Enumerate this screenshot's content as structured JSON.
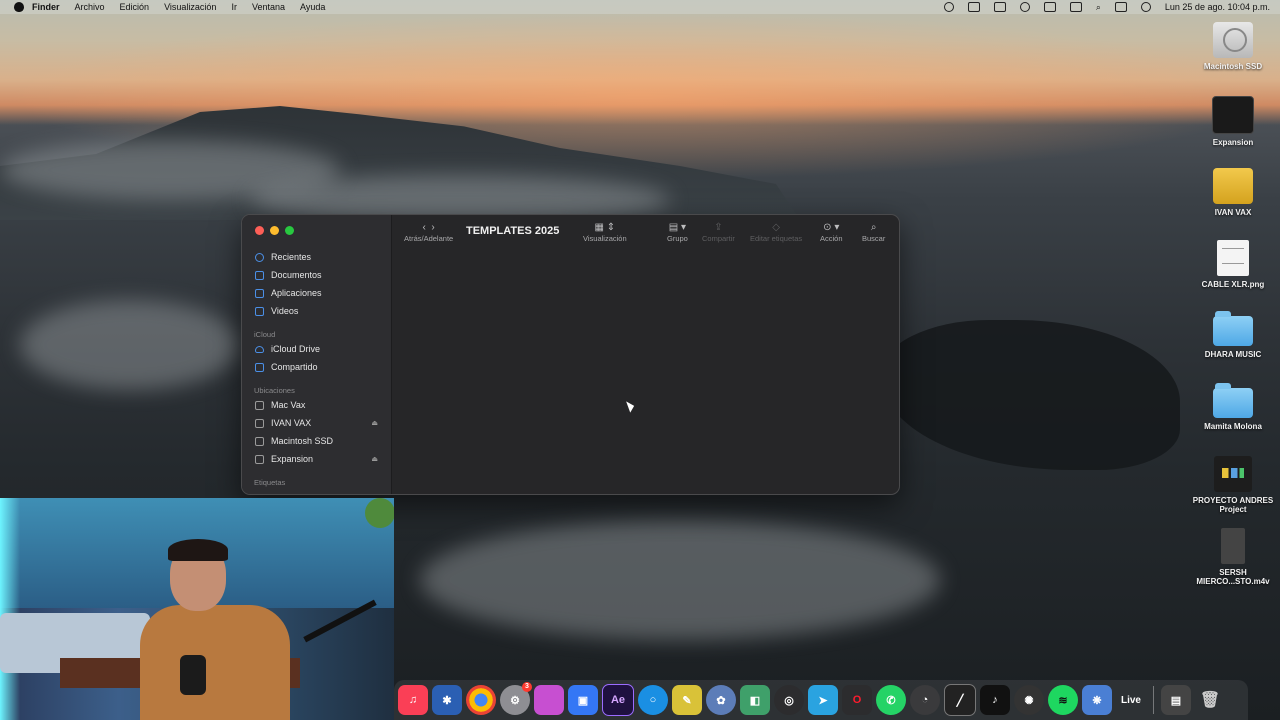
{
  "menubar": {
    "app": "Finder",
    "items": [
      "Archivo",
      "Edición",
      "Visualización",
      "Ir",
      "Ventana",
      "Ayuda"
    ],
    "datetime": "Lun 25 de ago. 10:04 p.m."
  },
  "finder": {
    "title": "TEMPLATES 2025",
    "toolbar": {
      "back_forward": "Atrás/Adelante",
      "view": "Visualización",
      "group": "Grupo",
      "share": "Compartir",
      "tags": "Editar etiquetas",
      "action": "Acción",
      "search": "Buscar"
    },
    "sidebar": {
      "favorites": [
        "Recientes",
        "Documentos",
        "Aplicaciones",
        "Videos"
      ],
      "icloud_header": "iCloud",
      "icloud": [
        "iCloud Drive",
        "Compartido"
      ],
      "locations_header": "Ubicaciones",
      "locations": [
        "Mac Vax",
        "IVAN VAX",
        "Macintosh SSD",
        "Expansion"
      ],
      "tags_header": "Etiquetas"
    }
  },
  "desktop": {
    "icons": [
      {
        "label": "Macintosh SSD",
        "kind": "hd-icon"
      },
      {
        "label": "Expansion",
        "kind": "drive-icon"
      },
      {
        "label": "IVAN VAX",
        "kind": "usb-drive-icon"
      },
      {
        "label": "CABLE XLR.png",
        "kind": "image-file-icon"
      },
      {
        "label": "DHARA MUSIC",
        "kind": "folder-icon"
      },
      {
        "label": "Mamita Molona",
        "kind": "folder-icon"
      },
      {
        "label": "PROYECTO ANDRES Project",
        "kind": "project-file-icon"
      },
      {
        "label": "SERSH MIERCO...STO.m4v",
        "kind": "video-file-icon"
      }
    ]
  },
  "dock": {
    "ae_label": "Ae",
    "live_label": "Live",
    "badge": "3"
  },
  "colors": {
    "close": "#fe5f57",
    "minimize": "#febc2e",
    "zoom": "#28c840",
    "sidebar_accent": "#4b8fe6"
  }
}
